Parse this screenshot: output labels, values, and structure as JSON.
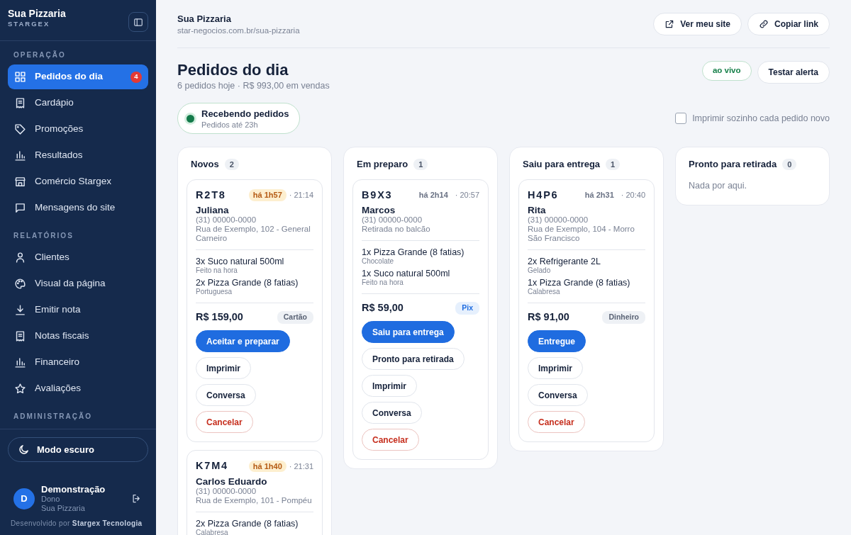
{
  "sidebar": {
    "brand": "Sua Pizzaria",
    "subbrand": "STARGEX",
    "sections": [
      {
        "label": "OPERAÇÃO",
        "items": [
          {
            "label": "Pedidos do dia",
            "selected": true,
            "badge": "4"
          },
          {
            "label": "Cardápio",
            "selected": false
          },
          {
            "label": "Promoções",
            "selected": false
          },
          {
            "label": "Resultados",
            "selected": false
          },
          {
            "label": "Comércio Stargex",
            "selected": false
          },
          {
            "label": "Mensagens do site",
            "selected": false
          }
        ]
      },
      {
        "label": "RELATÓRIOS",
        "items": [
          {
            "label": "Clientes",
            "selected": false
          },
          {
            "label": "Visual da página",
            "selected": false
          },
          {
            "label": "Emitir nota",
            "selected": false
          },
          {
            "label": "Notas fiscais",
            "selected": false
          },
          {
            "label": "Financeiro",
            "selected": false
          },
          {
            "label": "Avaliações",
            "selected": false
          }
        ]
      },
      {
        "label": "ADMINISTRAÇÃO"
      }
    ],
    "dark_mode_button": "Modo escuro",
    "user": {
      "initial": "D",
      "name": "Demonstração",
      "role": "Dono",
      "store": "Sua Pizzaria"
    },
    "footer": "Desenvolvido por **Stargex Tecnologia**"
  },
  "header": {
    "store": "Sua Pizzaria",
    "url": "star-negocios.com.br/sua-pizzaria",
    "buttons": [
      "Ver meu site",
      "Copiar link"
    ]
  },
  "page": {
    "title": "Pedidos do dia",
    "summary": "6 pedidos hoje · R$ 993,00 em vendas",
    "live": "ao vivo",
    "test_button": "Testar alerta",
    "status": {
      "title": "Recebendo pedidos",
      "subtitle": "Pedidos até 23h",
      "on": true
    },
    "auto_print": {
      "label": "Imprimir sozinho cada pedido novo",
      "checked": false
    }
  },
  "columns": [
    {
      "title": "Novos",
      "count": "2",
      "orders": [
        {
          "code": "R2T8",
          "age": "há 1h57",
          "urgent": true,
          "time": "· 21:14",
          "customer": "Juliana",
          "phone": "(31) 00000-0000",
          "address": "Rua de Exemplo, 102 - General Carneiro",
          "items": [
            {
              "name": "3x Suco natural 500ml",
              "note": "Feito na hora"
            },
            {
              "name": "2x Pizza Grande (8 fatias)",
              "note": "Portuguesa"
            }
          ],
          "total": "R$ 159,00",
          "payment": {
            "label": "Cartão",
            "kind": "neutral"
          },
          "actions": [
            {
              "label": "Aceitar e preparar",
              "kind": "primary"
            },
            {
              "label": "Imprimir",
              "kind": "outline"
            },
            {
              "label": "Conversa",
              "kind": "outline"
            },
            {
              "label": "Cancelar",
              "kind": "danger"
            }
          ]
        },
        {
          "code": "K7M4",
          "age": "há 1h40",
          "urgent": true,
          "time": "· 21:31",
          "customer": "Carlos Eduardo",
          "phone": "(31) 00000-0000",
          "address": "Rua de Exemplo, 101 - Pompéu",
          "items": [
            {
              "name": "2x Pizza Grande (8 fatias)",
              "note": "Calabresa"
            }
          ]
        }
      ]
    },
    {
      "title": "Em preparo",
      "count": "1",
      "orders": [
        {
          "code": "B9X3",
          "age": "há 2h14",
          "urgent": false,
          "time": "· 20:57",
          "customer": "Marcos",
          "phone": "(31) 00000-0000",
          "address": "Retirada no balcão",
          "items": [
            {
              "name": "1x Pizza Grande (8 fatias)",
              "note": "Chocolate"
            },
            {
              "name": "1x Suco natural 500ml",
              "note": "Feito na hora"
            }
          ],
          "total": "R$ 59,00",
          "payment": {
            "label": "Pix",
            "kind": "pix"
          },
          "actions": [
            {
              "label": "Saiu para entrega",
              "kind": "primary"
            },
            {
              "label": "Pronto para retirada",
              "kind": "outline"
            },
            {
              "label": "Imprimir",
              "kind": "outline"
            },
            {
              "label": "Conversa",
              "kind": "outline"
            },
            {
              "label": "Cancelar",
              "kind": "danger"
            }
          ]
        }
      ]
    },
    {
      "title": "Saiu para entrega",
      "count": "1",
      "orders": [
        {
          "code": "H4P6",
          "age": "há 2h31",
          "urgent": false,
          "time": "· 20:40",
          "customer": "Rita",
          "phone": "(31) 00000-0000",
          "address": "Rua de Exemplo, 104 - Morro São Francisco",
          "items": [
            {
              "name": "2x Refrigerante 2L",
              "note": "Gelado"
            },
            {
              "name": "1x Pizza Grande (8 fatias)",
              "note": "Calabresa"
            }
          ],
          "total": "R$ 91,00",
          "payment": {
            "label": "Dinheiro",
            "kind": "neutral"
          },
          "actions": [
            {
              "label": "Entregue",
              "kind": "primary"
            },
            {
              "label": "Imprimir",
              "kind": "outline"
            },
            {
              "label": "Conversa",
              "kind": "outline"
            },
            {
              "label": "Cancelar",
              "kind": "danger"
            }
          ]
        }
      ]
    },
    {
      "title": "Pronto para retirada",
      "count": "0",
      "empty": "Nada por aqui."
    }
  ]
}
